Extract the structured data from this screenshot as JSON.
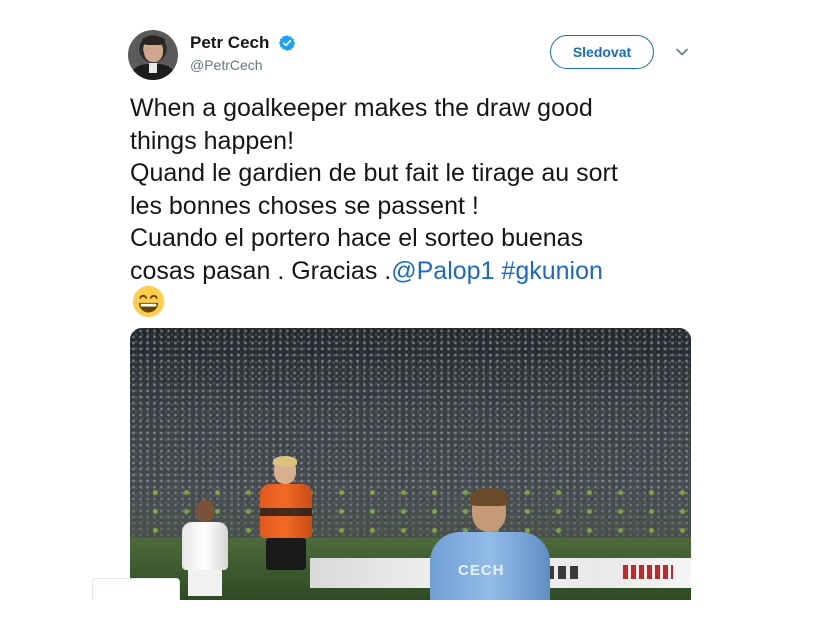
{
  "author": {
    "display_name": "Petr Cech",
    "handle": "@PetrCech",
    "verified": true
  },
  "follow_button": {
    "label": "Sledovat"
  },
  "tweet": {
    "lines": [
      "When a goalkeeper makes the draw good",
      "things happen!",
      "Quand le gardien de but fait le tirage au sort",
      "les bonnes choses se passent !",
      "Cuando el portero hace el sorteo buenas",
      "cosas pasan . Gracias ."
    ],
    "mention": "@Palop1",
    "hashtag": "#gkunion",
    "emoji": "grinning-face-with-smiling-eyes"
  },
  "media": {
    "jersey_text": "CECH",
    "board_text": "RUCKS"
  },
  "colors": {
    "link": "#1b6ac9",
    "text": "#14171a",
    "secondary": "#657786",
    "verified": "#1da1f2"
  }
}
